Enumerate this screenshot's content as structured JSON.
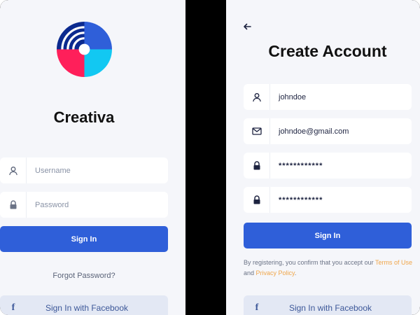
{
  "colors": {
    "accent_blue": "#2f5fd9",
    "terms_link": "#f0a64a",
    "logo_navy": "#0b2a8f",
    "logo_blue": "#2f5fd9",
    "logo_pink": "#ff1f5a",
    "logo_cyan": "#12c8f2",
    "panel_bg": "#f5f6fa",
    "facebook_bg": "#e3e8f4"
  },
  "login": {
    "app_name": "Creativa",
    "username": {
      "placeholder": "Username",
      "icon": "user-icon"
    },
    "password": {
      "placeholder": "Password",
      "icon": "lock-icon"
    },
    "sign_in_label": "Sign In",
    "forgot_password_label": "Forgot Password?",
    "facebook": {
      "icon": "facebook-icon",
      "label": "Sign In with Facebook"
    }
  },
  "register": {
    "back_icon": "back-arrow-icon",
    "title": "Create Account",
    "username": {
      "value": "johndoe",
      "icon": "user-icon"
    },
    "email": {
      "value": "johndoe@gmail.com",
      "icon": "mail-icon"
    },
    "password": {
      "value": "************",
      "icon": "lock-icon"
    },
    "confirm_password": {
      "value": "************",
      "icon": "lock-icon"
    },
    "sign_in_label": "Sign In",
    "terms": {
      "prefix": "By registering, you confirm that you accept our ",
      "terms_link": "Terms of Use",
      "middle": " and ",
      "privacy_link": "Privacy Policy",
      "suffix": "."
    },
    "facebook": {
      "icon": "facebook-icon",
      "label": "Sign In with Facebook"
    }
  }
}
